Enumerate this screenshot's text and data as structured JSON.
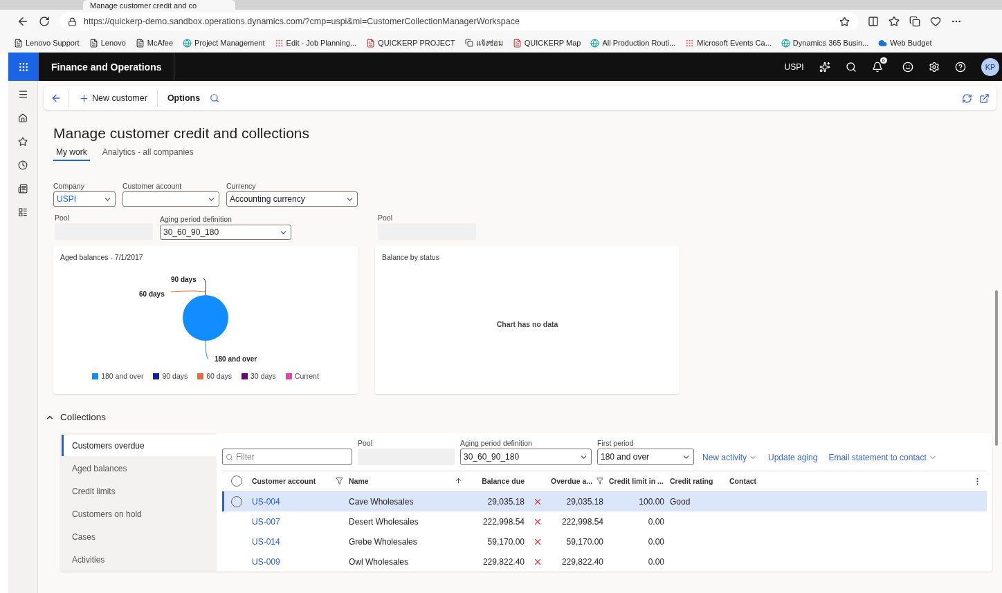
{
  "browser": {
    "tab_title": "Manage customer credit and co",
    "url": "https://quickerp-demo.sandbox.operations.dynamics.com/?cmp=uspi&mi=CustomerCollectionManagerWorkspace",
    "bookmarks": [
      {
        "label": "Lenovo Support",
        "kind": "page"
      },
      {
        "label": "Lenovo",
        "kind": "page"
      },
      {
        "label": "McAfee",
        "kind": "page"
      },
      {
        "label": "Project Management",
        "kind": "globe"
      },
      {
        "label": "Edit - Job Planning...",
        "kind": "tiles"
      },
      {
        "label": "QUICKERP PROJECT",
        "kind": "doc"
      },
      {
        "label": "แจ้งซ่อม",
        "kind": "badge"
      },
      {
        "label": "QUICKERP Map",
        "kind": "doc"
      },
      {
        "label": "All Production Routi...",
        "kind": "globe"
      },
      {
        "label": "Microsoft Events Ca...",
        "kind": "tiles"
      },
      {
        "label": "Dynamics 365 Busin...",
        "kind": "globe"
      },
      {
        "label": "Web Budget",
        "kind": "cloud"
      }
    ]
  },
  "app_bar": {
    "title": "Finance and Operations",
    "company": "USPI",
    "notifications": "6",
    "avatar": "KP"
  },
  "action_bar": {
    "new_label": "New customer",
    "options_label": "Options"
  },
  "page": {
    "title": "Manage customer credit and collections",
    "tabs": [
      {
        "label": "My work",
        "selected": true
      },
      {
        "label": "Analytics - all companies",
        "selected": false
      }
    ],
    "filters": [
      {
        "label": "Company",
        "value": "USPI"
      },
      {
        "label": "Customer account"
      },
      {
        "label": "Currency",
        "value": "Accounting currency"
      }
    ],
    "pool_label": "Pool",
    "aging_label": "Aging period definition",
    "aging_value": "30_60_90_180",
    "pool2_label": "Pool"
  },
  "aged_chart": {
    "title": "Aged balances - 7/1/2017",
    "slice_labels": [
      "90 days",
      "60 days",
      "180 and over"
    ],
    "legend": [
      {
        "label": "180 and over",
        "color": "#118dff"
      },
      {
        "label": "90 days",
        "color": "#12239e"
      },
      {
        "label": "60 days",
        "color": "#e66c37"
      },
      {
        "label": "30 days",
        "color": "#6b007b"
      },
      {
        "label": "Current",
        "color": "#e044a7"
      }
    ]
  },
  "status_chart": {
    "title": "Balance by status",
    "empty_text": "Chart has no data"
  },
  "collections": {
    "title": "Collections",
    "expanded": true,
    "nav": [
      {
        "label": "Customers overdue",
        "selected": true
      },
      {
        "label": "Aged balances",
        "selected": false
      },
      {
        "label": "Credit limits",
        "selected": false
      },
      {
        "label": "Customers on hold",
        "selected": false
      },
      {
        "label": "Cases",
        "selected": false
      },
      {
        "label": "Activities",
        "selected": false
      }
    ],
    "filter_placeholder": "Filter",
    "pool_label": "Pool",
    "aging_label": "Aging period definition",
    "aging_value": "30_60_90_180",
    "first_period_label": "First period",
    "first_period_value": "180 and over",
    "actions": [
      {
        "label": "New activity",
        "dropdown": true
      },
      {
        "label": "Update aging",
        "dropdown": false
      },
      {
        "label": "Email statement to contact",
        "dropdown": true
      }
    ],
    "all_selected": false,
    "columns": [
      "Customer account",
      "Name",
      "Balance due",
      "Overdue a...",
      "Credit limit in ...",
      "Credit rating",
      "Contact"
    ],
    "rows": [
      {
        "account": "US-004",
        "name": "Cave Wholesales",
        "balance": "29,035.18",
        "flagged": true,
        "overdue": "29,035.18",
        "limit": "100.00",
        "rating": "Good",
        "selected": true
      },
      {
        "account": "US-007",
        "name": "Desert Wholesales",
        "balance": "222,998.54",
        "flagged": true,
        "overdue": "222,998.54",
        "limit": "0.00",
        "selected": false
      },
      {
        "account": "US-014",
        "name": "Grebe Wholesales",
        "balance": "59,170.00",
        "flagged": true,
        "overdue": "59,170.00",
        "limit": "0.00",
        "selected": false
      },
      {
        "account": "US-009",
        "name": "Owl Wholesales",
        "balance": "229,822.40",
        "flagged": true,
        "overdue": "229,822.40",
        "limit": "0.00",
        "selected": false
      }
    ]
  }
}
